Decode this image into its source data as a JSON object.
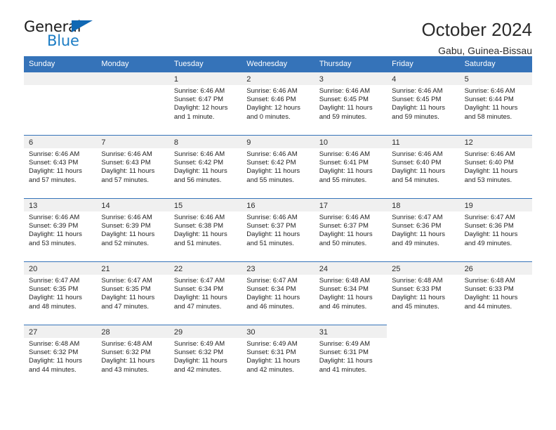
{
  "brand": {
    "name_top": "General",
    "name_bottom": "Blue",
    "triangle_color": "#1068b4",
    "blue_text_color": "#1b7cc4"
  },
  "header": {
    "title": "October 2024",
    "subtitle": "Gabu, Guinea-Bissau"
  },
  "theme": {
    "header_blue": "#3573b9",
    "datebar_grey": "#f0f0f0",
    "text": "#1f1f1f"
  },
  "weekdays": [
    "Sunday",
    "Monday",
    "Tuesday",
    "Wednesday",
    "Thursday",
    "Friday",
    "Saturday"
  ],
  "weeks": [
    [
      {
        "day": "",
        "sunrise": "",
        "sunset": "",
        "daylight_line1": "",
        "daylight_line2": "",
        "state": "blank-lead"
      },
      {
        "day": "",
        "sunrise": "",
        "sunset": "",
        "daylight_line1": "",
        "daylight_line2": "",
        "state": "blank-lead"
      },
      {
        "day": "1",
        "sunrise": "Sunrise: 6:46 AM",
        "sunset": "Sunset: 6:47 PM",
        "daylight_line1": "Daylight: 12 hours",
        "daylight_line2": "and 1 minute.",
        "state": "filled"
      },
      {
        "day": "2",
        "sunrise": "Sunrise: 6:46 AM",
        "sunset": "Sunset: 6:46 PM",
        "daylight_line1": "Daylight: 12 hours",
        "daylight_line2": "and 0 minutes.",
        "state": "filled"
      },
      {
        "day": "3",
        "sunrise": "Sunrise: 6:46 AM",
        "sunset": "Sunset: 6:45 PM",
        "daylight_line1": "Daylight: 11 hours",
        "daylight_line2": "and 59 minutes.",
        "state": "filled"
      },
      {
        "day": "4",
        "sunrise": "Sunrise: 6:46 AM",
        "sunset": "Sunset: 6:45 PM",
        "daylight_line1": "Daylight: 11 hours",
        "daylight_line2": "and 59 minutes.",
        "state": "filled"
      },
      {
        "day": "5",
        "sunrise": "Sunrise: 6:46 AM",
        "sunset": "Sunset: 6:44 PM",
        "daylight_line1": "Daylight: 11 hours",
        "daylight_line2": "and 58 minutes.",
        "state": "filled"
      }
    ],
    [
      {
        "day": "6",
        "sunrise": "Sunrise: 6:46 AM",
        "sunset": "Sunset: 6:43 PM",
        "daylight_line1": "Daylight: 11 hours",
        "daylight_line2": "and 57 minutes.",
        "state": "filled"
      },
      {
        "day": "7",
        "sunrise": "Sunrise: 6:46 AM",
        "sunset": "Sunset: 6:43 PM",
        "daylight_line1": "Daylight: 11 hours",
        "daylight_line2": "and 57 minutes.",
        "state": "filled"
      },
      {
        "day": "8",
        "sunrise": "Sunrise: 6:46 AM",
        "sunset": "Sunset: 6:42 PM",
        "daylight_line1": "Daylight: 11 hours",
        "daylight_line2": "and 56 minutes.",
        "state": "filled"
      },
      {
        "day": "9",
        "sunrise": "Sunrise: 6:46 AM",
        "sunset": "Sunset: 6:42 PM",
        "daylight_line1": "Daylight: 11 hours",
        "daylight_line2": "and 55 minutes.",
        "state": "filled"
      },
      {
        "day": "10",
        "sunrise": "Sunrise: 6:46 AM",
        "sunset": "Sunset: 6:41 PM",
        "daylight_line1": "Daylight: 11 hours",
        "daylight_line2": "and 55 minutes.",
        "state": "filled"
      },
      {
        "day": "11",
        "sunrise": "Sunrise: 6:46 AM",
        "sunset": "Sunset: 6:40 PM",
        "daylight_line1": "Daylight: 11 hours",
        "daylight_line2": "and 54 minutes.",
        "state": "filled"
      },
      {
        "day": "12",
        "sunrise": "Sunrise: 6:46 AM",
        "sunset": "Sunset: 6:40 PM",
        "daylight_line1": "Daylight: 11 hours",
        "daylight_line2": "and 53 minutes.",
        "state": "filled"
      }
    ],
    [
      {
        "day": "13",
        "sunrise": "Sunrise: 6:46 AM",
        "sunset": "Sunset: 6:39 PM",
        "daylight_line1": "Daylight: 11 hours",
        "daylight_line2": "and 53 minutes.",
        "state": "filled"
      },
      {
        "day": "14",
        "sunrise": "Sunrise: 6:46 AM",
        "sunset": "Sunset: 6:39 PM",
        "daylight_line1": "Daylight: 11 hours",
        "daylight_line2": "and 52 minutes.",
        "state": "filled"
      },
      {
        "day": "15",
        "sunrise": "Sunrise: 6:46 AM",
        "sunset": "Sunset: 6:38 PM",
        "daylight_line1": "Daylight: 11 hours",
        "daylight_line2": "and 51 minutes.",
        "state": "filled"
      },
      {
        "day": "16",
        "sunrise": "Sunrise: 6:46 AM",
        "sunset": "Sunset: 6:37 PM",
        "daylight_line1": "Daylight: 11 hours",
        "daylight_line2": "and 51 minutes.",
        "state": "filled"
      },
      {
        "day": "17",
        "sunrise": "Sunrise: 6:46 AM",
        "sunset": "Sunset: 6:37 PM",
        "daylight_line1": "Daylight: 11 hours",
        "daylight_line2": "and 50 minutes.",
        "state": "filled"
      },
      {
        "day": "18",
        "sunrise": "Sunrise: 6:47 AM",
        "sunset": "Sunset: 6:36 PM",
        "daylight_line1": "Daylight: 11 hours",
        "daylight_line2": "and 49 minutes.",
        "state": "filled"
      },
      {
        "day": "19",
        "sunrise": "Sunrise: 6:47 AM",
        "sunset": "Sunset: 6:36 PM",
        "daylight_line1": "Daylight: 11 hours",
        "daylight_line2": "and 49 minutes.",
        "state": "filled"
      }
    ],
    [
      {
        "day": "20",
        "sunrise": "Sunrise: 6:47 AM",
        "sunset": "Sunset: 6:35 PM",
        "daylight_line1": "Daylight: 11 hours",
        "daylight_line2": "and 48 minutes.",
        "state": "filled"
      },
      {
        "day": "21",
        "sunrise": "Sunrise: 6:47 AM",
        "sunset": "Sunset: 6:35 PM",
        "daylight_line1": "Daylight: 11 hours",
        "daylight_line2": "and 47 minutes.",
        "state": "filled"
      },
      {
        "day": "22",
        "sunrise": "Sunrise: 6:47 AM",
        "sunset": "Sunset: 6:34 PM",
        "daylight_line1": "Daylight: 11 hours",
        "daylight_line2": "and 47 minutes.",
        "state": "filled"
      },
      {
        "day": "23",
        "sunrise": "Sunrise: 6:47 AM",
        "sunset": "Sunset: 6:34 PM",
        "daylight_line1": "Daylight: 11 hours",
        "daylight_line2": "and 46 minutes.",
        "state": "filled"
      },
      {
        "day": "24",
        "sunrise": "Sunrise: 6:48 AM",
        "sunset": "Sunset: 6:34 PM",
        "daylight_line1": "Daylight: 11 hours",
        "daylight_line2": "and 46 minutes.",
        "state": "filled"
      },
      {
        "day": "25",
        "sunrise": "Sunrise: 6:48 AM",
        "sunset": "Sunset: 6:33 PM",
        "daylight_line1": "Daylight: 11 hours",
        "daylight_line2": "and 45 minutes.",
        "state": "filled"
      },
      {
        "day": "26",
        "sunrise": "Sunrise: 6:48 AM",
        "sunset": "Sunset: 6:33 PM",
        "daylight_line1": "Daylight: 11 hours",
        "daylight_line2": "and 44 minutes.",
        "state": "filled"
      }
    ],
    [
      {
        "day": "27",
        "sunrise": "Sunrise: 6:48 AM",
        "sunset": "Sunset: 6:32 PM",
        "daylight_line1": "Daylight: 11 hours",
        "daylight_line2": "and 44 minutes.",
        "state": "filled"
      },
      {
        "day": "28",
        "sunrise": "Sunrise: 6:48 AM",
        "sunset": "Sunset: 6:32 PM",
        "daylight_line1": "Daylight: 11 hours",
        "daylight_line2": "and 43 minutes.",
        "state": "filled"
      },
      {
        "day": "29",
        "sunrise": "Sunrise: 6:49 AM",
        "sunset": "Sunset: 6:32 PM",
        "daylight_line1": "Daylight: 11 hours",
        "daylight_line2": "and 42 minutes.",
        "state": "filled"
      },
      {
        "day": "30",
        "sunrise": "Sunrise: 6:49 AM",
        "sunset": "Sunset: 6:31 PM",
        "daylight_line1": "Daylight: 11 hours",
        "daylight_line2": "and 42 minutes.",
        "state": "filled"
      },
      {
        "day": "31",
        "sunrise": "Sunrise: 6:49 AM",
        "sunset": "Sunset: 6:31 PM",
        "daylight_line1": "Daylight: 11 hours",
        "daylight_line2": "and 41 minutes.",
        "state": "filled"
      },
      {
        "day": "",
        "sunrise": "",
        "sunset": "",
        "daylight_line1": "",
        "daylight_line2": "",
        "state": "empty"
      },
      {
        "day": "",
        "sunrise": "",
        "sunset": "",
        "daylight_line1": "",
        "daylight_line2": "",
        "state": "empty"
      }
    ]
  ]
}
